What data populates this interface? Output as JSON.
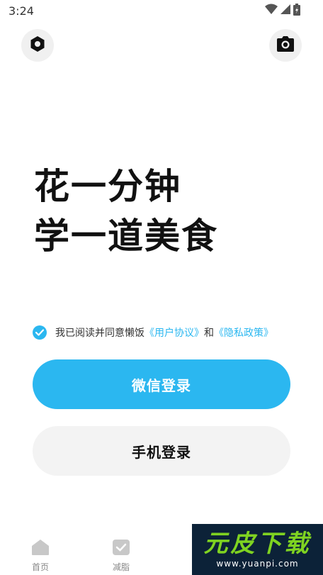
{
  "status_bar": {
    "time": "3:24",
    "icons": [
      "wifi-icon",
      "signal-icon",
      "battery-icon"
    ]
  },
  "top_buttons": {
    "left_icon": "settings-icon",
    "right_icon": "camera-icon"
  },
  "headline": {
    "line1": "花一分钟",
    "line2": "学一道美食"
  },
  "agreement": {
    "checked": true,
    "text": "我已阅读并同意懒饭",
    "user_agreement": "《用户协议》",
    "and": "和",
    "privacy_policy": "《隐私政策》"
  },
  "login": {
    "wechat_label": "微信登录",
    "phone_label": "手机登录"
  },
  "tabbar": {
    "items": [
      {
        "label": "首页",
        "icon": "home-icon"
      },
      {
        "label": "减脂",
        "icon": "shield-check-icon"
      },
      {
        "label": "",
        "icon": "tab-icon"
      },
      {
        "label": "",
        "icon": "tab-icon"
      }
    ]
  },
  "watermark": {
    "logo": "元皮下载",
    "url": "www.yuanpi.com"
  },
  "colors": {
    "accent": "#2bb7f0",
    "button_secondary": "#f3f3f3",
    "text_dark": "#111111"
  }
}
